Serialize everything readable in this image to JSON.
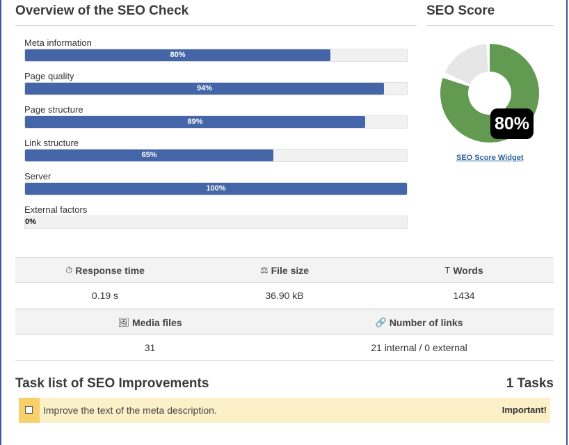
{
  "overview": {
    "title": "Overview of the SEO Check",
    "categories": [
      {
        "label": "Meta information",
        "percent": 80,
        "percent_label": "80%"
      },
      {
        "label": "Page quality",
        "percent": 94,
        "percent_label": "94%"
      },
      {
        "label": "Page structure",
        "percent": 89,
        "percent_label": "89%"
      },
      {
        "label": "Link structure",
        "percent": 65,
        "percent_label": "65%"
      },
      {
        "label": "Server",
        "percent": 100,
        "percent_label": "100%"
      },
      {
        "label": "External factors",
        "percent": 0,
        "percent_label": "0%"
      }
    ]
  },
  "score": {
    "title": "SEO Score",
    "value": 80,
    "value_label": "80%",
    "widget_link": "SEO Score Widget",
    "color_score": "#639a52",
    "color_rest": "#e6e6e6"
  },
  "stats": {
    "response_time": {
      "label": "Response time",
      "value": "0.19 s",
      "icon": "stopwatch-icon"
    },
    "file_size": {
      "label": "File size",
      "value": "36.90 kB",
      "icon": "scale-icon"
    },
    "words": {
      "label": "Words",
      "value": "1434",
      "icon": "text-size-icon"
    },
    "media_files": {
      "label": "Media files",
      "value": "31",
      "icon": "image-icon"
    },
    "number_of_links": {
      "label": "Number of links",
      "value": "21 internal / 0 external",
      "icon": "link-icon"
    }
  },
  "tasks": {
    "title": "Task list of SEO Improvements",
    "count_label": "1 Tasks",
    "items": [
      {
        "text": "Improve the text of the meta description.",
        "badge": "Important!",
        "checked": false
      }
    ]
  }
}
